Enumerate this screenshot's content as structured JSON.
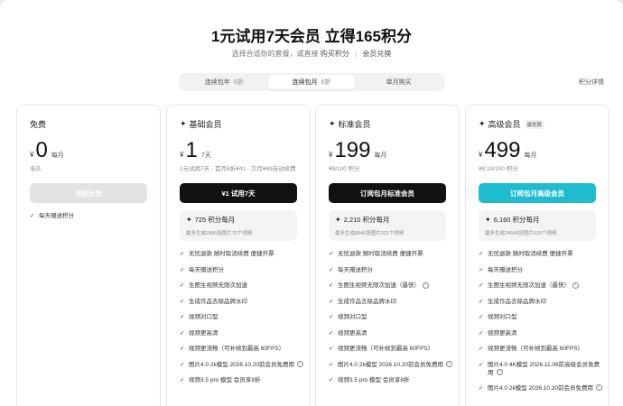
{
  "header": {
    "headline": "1元试用7天会员 立得165积分",
    "subtitle": "选择合适你的套餐，或直接",
    "buy_points": "购买积分",
    "separator": "|",
    "redeem": "会员兑换"
  },
  "tabs": [
    {
      "label": "连续包年",
      "discount": "6折"
    },
    {
      "label": "连续包月",
      "discount": "6折",
      "active": true
    },
    {
      "label": "单月购买",
      "discount": ""
    }
  ],
  "points_detail": "积分详情",
  "plans": [
    {
      "title": "免费",
      "icon": "",
      "badge": "",
      "currency": "¥",
      "price": "0",
      "period": "每月",
      "note": "永久",
      "cta": "当前计划",
      "cta_style": "disabled",
      "points": null,
      "features": [
        {
          "text": "每天赠送积分"
        }
      ]
    },
    {
      "title": "基础会员",
      "icon": "sparkle-icon",
      "badge": "",
      "currency": "¥",
      "price": "1",
      "period": "7天",
      "note": "1元试用7天 - 首月6折¥41 - 次月¥69自动续费",
      "cta": "¥1 试用7天",
      "cta_style": "dark",
      "points": {
        "main": "725 积分每月",
        "sub": "最多生成2900张图片72个视频"
      },
      "features": [
        {
          "text": "无忧退款 随时取消续费 便捷开票"
        },
        {
          "text": "每天赠送积分"
        },
        {
          "text": "生图生视频无限次加速"
        },
        {
          "text": "生成作品去除品牌水印"
        },
        {
          "text": "视频对口型"
        },
        {
          "text": "视频更高清"
        },
        {
          "text": "视频更流畅（可补帧到最高 60FPS）"
        },
        {
          "text": "图片4.0 2k模型 2026.10.20前会员免费用",
          "info": true
        },
        {
          "text": "视频3.5 pro 模型 会员享8折"
        }
      ]
    },
    {
      "title": "标准会员",
      "icon": "sparkle-icon",
      "badge": "",
      "currency": "¥",
      "price": "199",
      "period": "每月",
      "note": "¥9/100 积分",
      "cta": "订阅包月标准会员",
      "cta_style": "dark",
      "points": {
        "main": "2,210 积分每月",
        "sub": "最多生成8840张图片221个视频"
      },
      "features": [
        {
          "text": "无忧退款 随时取消续费 便捷开票"
        },
        {
          "text": "每天赠送积分"
        },
        {
          "text": "生图生视频无限次加速（最快）",
          "info": true
        },
        {
          "text": "生成作品去除品牌水印"
        },
        {
          "text": "视频对口型"
        },
        {
          "text": "视频更高清"
        },
        {
          "text": "视频更流畅（可补帧到最高 60FPS）"
        },
        {
          "text": "图片4.0 2k模型 2026.10.20前会员免费用",
          "info": true
        },
        {
          "text": "视频3.5 pro 模型 会员享8折"
        }
      ]
    },
    {
      "title": "高级会员",
      "icon": "sparkle-icon",
      "badge": "最划算",
      "currency": "¥",
      "price": "499",
      "period": "每月",
      "note": "¥8.10/100 积分",
      "cta": "订阅包月高级会员",
      "cta_style": "teal",
      "points": {
        "main": "6,160 积分每月",
        "sub": "最多生成24640张图片616个视频"
      },
      "features": [
        {
          "text": "无忧退款 随时取消续费 便捷开票"
        },
        {
          "text": "每天赠送积分"
        },
        {
          "text": "生图生视频无限次加速（最快）",
          "info": true
        },
        {
          "text": "生成作品去除品牌水印"
        },
        {
          "text": "视频对口型"
        },
        {
          "text": "视频更高清"
        },
        {
          "text": "视频更流畅（可补帧到最高 60FPS）"
        },
        {
          "text": "图片4.0 4K模型 2026.11.06前高级会员免费用",
          "info": true,
          "tall": true
        },
        {
          "text": "图片4.0 2k模型 2026.10.20前会员免费用",
          "info": true
        }
      ]
    }
  ],
  "colors": {
    "accent_teal": "#1fbccf",
    "dark_button": "#111111",
    "disabled_button": "#e3e3e3"
  }
}
